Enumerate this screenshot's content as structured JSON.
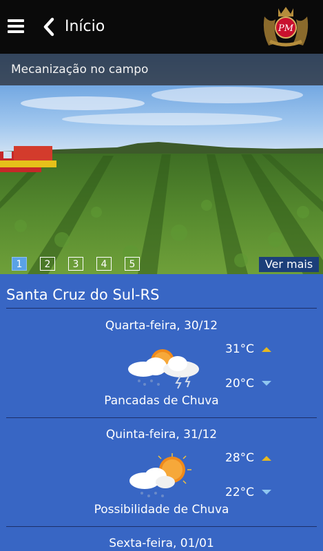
{
  "header": {
    "title": "Início",
    "menu_icon": "hamburger-icon",
    "back_icon": "chevron-left-icon",
    "logo_text": "PM"
  },
  "hero": {
    "caption": "Mecanização no campo",
    "pages": [
      "1",
      "2",
      "3",
      "4",
      "5"
    ],
    "active_page": "1",
    "more_label": "Ver mais"
  },
  "weather": {
    "city": "Santa Cruz do Sul-RS",
    "days": [
      {
        "date": "Quarta-feira, 30/12",
        "max": "31°C",
        "min": "20°C",
        "condition": "Pancadas de Chuva",
        "icon": "storm-cloud-sun-icon"
      },
      {
        "date": "Quinta-feira, 31/12",
        "max": "28°C",
        "min": "22°C",
        "condition": "Possibilidade de Chuva",
        "icon": "sun-cloud-rain-icon"
      },
      {
        "date": "Sexta-feira, 01/01"
      }
    ]
  },
  "colors": {
    "topbar": "#0a0a0a",
    "weather_bg": "#3866c4",
    "max_arrow": "#e6b820",
    "min_arrow": "#8fc6f0",
    "more_bg": "#1c3f7a"
  }
}
